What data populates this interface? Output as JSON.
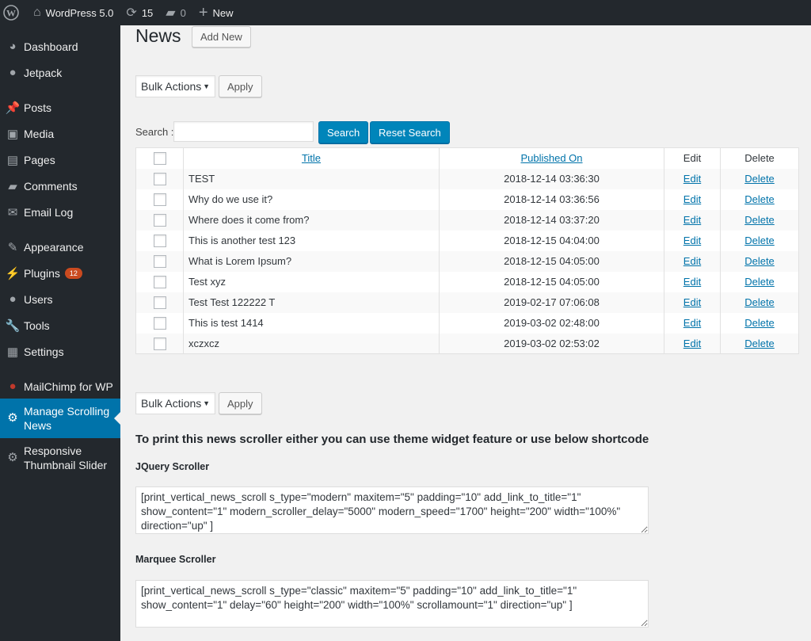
{
  "adminbar": {
    "site": "WordPress 5.0",
    "updates": "15",
    "comments": "0",
    "new": "New"
  },
  "sidebar": {
    "items": [
      {
        "label": "Dashboard",
        "icon": "dashboard-icon"
      },
      {
        "label": "Jetpack",
        "icon": "jetpack-icon"
      },
      {
        "label": "Posts",
        "icon": "pin-icon"
      },
      {
        "label": "Media",
        "icon": "media-icon"
      },
      {
        "label": "Pages",
        "icon": "pages-icon"
      },
      {
        "label": "Comments",
        "icon": "comment-icon"
      },
      {
        "label": "Email Log",
        "icon": "email-icon"
      },
      {
        "label": "Appearance",
        "icon": "brush-icon"
      },
      {
        "label": "Plugins",
        "icon": "plugin-icon",
        "badge": "12"
      },
      {
        "label": "Users",
        "icon": "user-icon"
      },
      {
        "label": "Tools",
        "icon": "wrench-icon"
      },
      {
        "label": "Settings",
        "icon": "settings-icon"
      },
      {
        "label": "MailChimp for WP",
        "icon": "mailchimp-icon"
      },
      {
        "label": "Manage Scrolling News",
        "icon": "gear-icon",
        "active": true
      },
      {
        "label": "Responsive Thumbnail Slider",
        "icon": "gear-icon"
      }
    ]
  },
  "page": {
    "title": "News",
    "add_new": "Add New",
    "bulk_actions": "Bulk Actions",
    "apply": "Apply",
    "search_label": "Search :",
    "search_value": "",
    "search_button": "Search",
    "reset_button": "Reset Search"
  },
  "table": {
    "headers": {
      "title": "Title",
      "published": "Published On",
      "edit": "Edit",
      "delete": "Delete"
    },
    "rows": [
      {
        "title": "TEST",
        "date": "2018-12-14 03:36:30"
      },
      {
        "title": "Why do we use it?",
        "date": "2018-12-14 03:36:56"
      },
      {
        "title": "Where does it come from?",
        "date": "2018-12-14 03:37:20"
      },
      {
        "title": "This is another test 123",
        "date": "2018-12-15 04:04:00"
      },
      {
        "title": "What is Lorem Ipsum?",
        "date": "2018-12-15 04:05:00"
      },
      {
        "title": "Test xyz",
        "date": "2018-12-15 04:05:00"
      },
      {
        "title": "Test Test 122222 T",
        "date": "2019-02-17 07:06:08"
      },
      {
        "title": "This is test 1414",
        "date": "2019-03-02 02:48:00"
      },
      {
        "title": "xczxcz",
        "date": "2019-03-02 02:53:02"
      }
    ],
    "edit_label": "Edit",
    "delete_label": "Delete"
  },
  "shortcodes": {
    "heading": "To print this news scroller either you can use theme widget feature or use below shortcode",
    "jquery_label": "JQuery Scroller",
    "jquery_code": "[print_vertical_news_scroll s_type=\"modern\" maxitem=\"5\" padding=\"10\" add_link_to_title=\"1\" show_content=\"1\" modern_scroller_delay=\"5000\" modern_speed=\"1700\" height=\"200\" width=\"100%\" direction=\"up\" ]",
    "marquee_label": "Marquee Scroller",
    "marquee_code": "[print_vertical_news_scroll s_type=\"classic\" maxitem=\"5\" padding=\"10\" add_link_to_title=\"1\" show_content=\"1\" delay=\"60\" height=\"200\" width=\"100%\" scrollamount=\"1\" direction=\"up\" ]"
  },
  "colors": {
    "sidebar": "#23282d",
    "active": "#0073aa",
    "primary_button": "#0085ba",
    "link": "#0073aa",
    "badge": "#ca4a1f"
  }
}
